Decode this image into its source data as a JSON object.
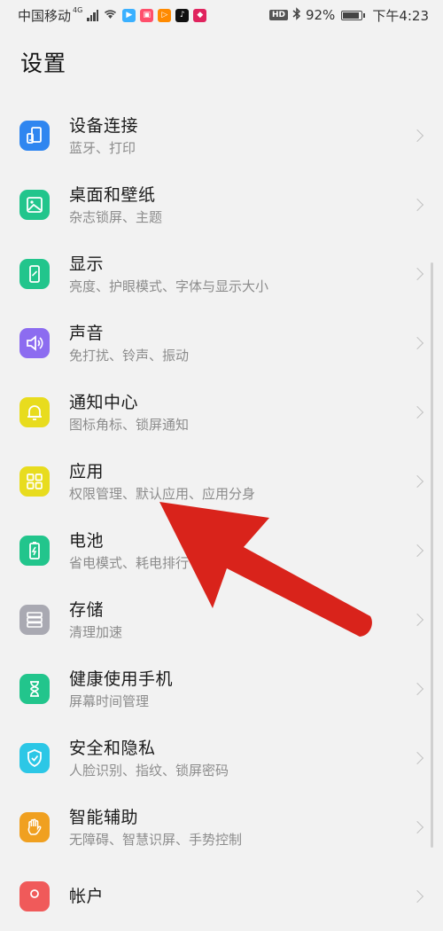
{
  "status_bar": {
    "carrier": "中国移动",
    "network_type": "4G",
    "battery_percent": "92%",
    "battery_level": 0.92,
    "time": "下午4:23",
    "hd_label": "HD"
  },
  "page": {
    "title": "设置"
  },
  "settings": [
    {
      "title": "设备连接",
      "subtitle": "蓝牙、打印",
      "icon": "device-connection-icon",
      "color": "#2f86f0"
    },
    {
      "title": "桌面和壁纸",
      "subtitle": "杂志锁屏、主题",
      "icon": "wallpaper-icon",
      "color": "#22c58c"
    },
    {
      "title": "显示",
      "subtitle": "亮度、护眼模式、字体与显示大小",
      "icon": "display-icon",
      "color": "#22c58c"
    },
    {
      "title": "声音",
      "subtitle": "免打扰、铃声、振动",
      "icon": "sound-icon",
      "color": "#8c6cf0"
    },
    {
      "title": "通知中心",
      "subtitle": "图标角标、锁屏通知",
      "icon": "bell-icon",
      "color": "#e8dc1e"
    },
    {
      "title": "应用",
      "subtitle": "权限管理、默认应用、应用分身",
      "icon": "apps-icon",
      "color": "#e8dc1e"
    },
    {
      "title": "电池",
      "subtitle": "省电模式、耗电排行",
      "icon": "battery-icon",
      "color": "#22c58c"
    },
    {
      "title": "存储",
      "subtitle": "清理加速",
      "icon": "storage-icon",
      "color": "#a9a9b2"
    },
    {
      "title": "健康使用手机",
      "subtitle": "屏幕时间管理",
      "icon": "hourglass-icon",
      "color": "#22c58c"
    },
    {
      "title": "安全和隐私",
      "subtitle": "人脸识别、指纹、锁屏密码",
      "icon": "shield-icon",
      "color": "#2cc7e6"
    },
    {
      "title": "智能辅助",
      "subtitle": "无障碍、智慧识屏、手势控制",
      "icon": "hand-icon",
      "color": "#f0a020"
    },
    {
      "title": "帐户",
      "subtitle": "",
      "icon": "account-icon",
      "color": "#f05a5a"
    }
  ],
  "annotation": {
    "color": "#d9231b"
  }
}
